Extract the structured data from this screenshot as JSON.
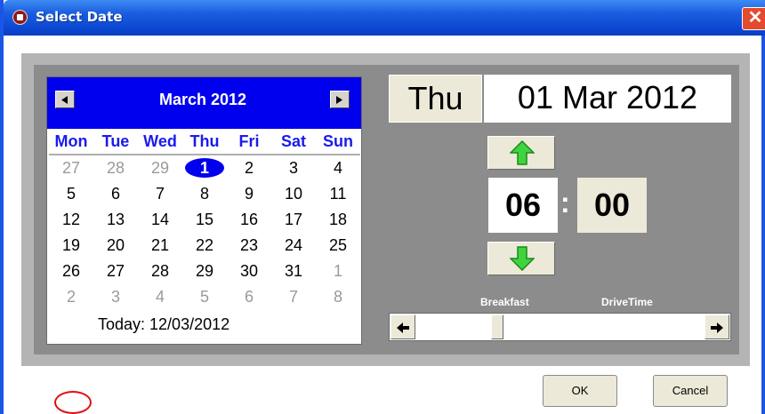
{
  "window": {
    "title": "Select Date",
    "close_label": "✕"
  },
  "calendar": {
    "month_label": "March 2012",
    "weekdays": [
      "Mon",
      "Tue",
      "Wed",
      "Thu",
      "Fri",
      "Sat",
      "Sun"
    ],
    "weeks": [
      [
        {
          "d": "27",
          "other": true
        },
        {
          "d": "28",
          "other": true
        },
        {
          "d": "29",
          "other": true
        },
        {
          "d": "1",
          "selected": true
        },
        {
          "d": "2"
        },
        {
          "d": "3"
        },
        {
          "d": "4"
        }
      ],
      [
        {
          "d": "5"
        },
        {
          "d": "6"
        },
        {
          "d": "7"
        },
        {
          "d": "8"
        },
        {
          "d": "9"
        },
        {
          "d": "10"
        },
        {
          "d": "11"
        }
      ],
      [
        {
          "d": "12",
          "today": true
        },
        {
          "d": "13"
        },
        {
          "d": "14"
        },
        {
          "d": "15"
        },
        {
          "d": "16"
        },
        {
          "d": "17"
        },
        {
          "d": "18"
        }
      ],
      [
        {
          "d": "19"
        },
        {
          "d": "20"
        },
        {
          "d": "21"
        },
        {
          "d": "22"
        },
        {
          "d": "23"
        },
        {
          "d": "24"
        },
        {
          "d": "25"
        }
      ],
      [
        {
          "d": "26"
        },
        {
          "d": "27"
        },
        {
          "d": "28"
        },
        {
          "d": "29"
        },
        {
          "d": "30"
        },
        {
          "d": "31"
        },
        {
          "d": "1",
          "other": true
        }
      ],
      [
        {
          "d": "2",
          "other": true
        },
        {
          "d": "3",
          "other": true
        },
        {
          "d": "4",
          "other": true
        },
        {
          "d": "5",
          "other": true
        },
        {
          "d": "6",
          "other": true
        },
        {
          "d": "7",
          "other": true
        },
        {
          "d": "8",
          "other": true
        }
      ]
    ],
    "today_label": "Today: 12/03/2012"
  },
  "selected": {
    "weekday": "Thu",
    "date": "01 Mar 2012"
  },
  "time": {
    "hours": "06",
    "minutes": "00",
    "separator": ":"
  },
  "slider": {
    "labels": [
      "Breakfast",
      "DriveTime"
    ],
    "left_icon": "left-arrow-icon",
    "right_icon": "right-arrow-icon",
    "position": 0.27
  },
  "buttons": {
    "ok": "OK",
    "cancel": "Cancel"
  },
  "colors": {
    "titlebar": "#0a47d2",
    "calendar_header": "#0000ee",
    "selected_day": "#0000ee",
    "today_marker": "#e01010",
    "spin_arrow": "#3fd43f",
    "panel": "#8c8c8c"
  }
}
